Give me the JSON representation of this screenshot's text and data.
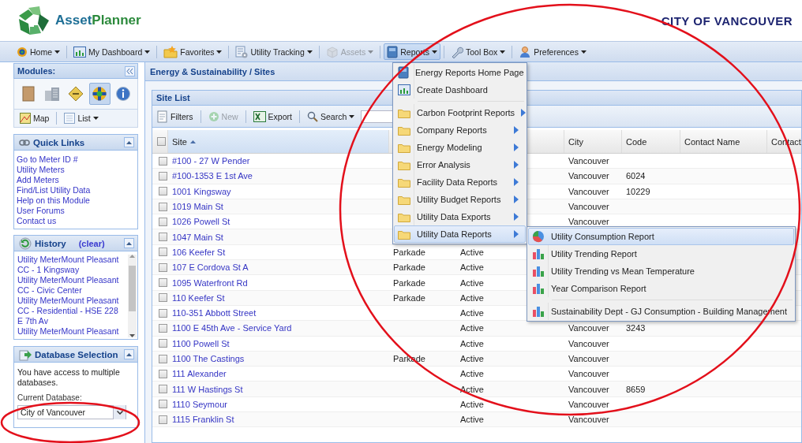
{
  "header": {
    "logo": [
      {
        "text": "Asset",
        "kind": "accent"
      },
      {
        "text": "Planner",
        "kind": "plain"
      }
    ],
    "organization": "CITY OF VANCOUVER"
  },
  "toolbar": [
    {
      "label": "Home",
      "dropdown": true,
      "disabled": false,
      "pressed": false
    },
    {
      "label": "My Dashboard",
      "dropdown": true,
      "disabled": false,
      "pressed": false
    },
    {
      "label": "Favorites",
      "dropdown": true,
      "disabled": false,
      "pressed": false
    },
    {
      "label": "Utility Tracking",
      "dropdown": true,
      "disabled": false,
      "pressed": false
    },
    {
      "label": "Assets",
      "dropdown": true,
      "disabled": true,
      "pressed": false
    },
    {
      "label": "Reports",
      "dropdown": true,
      "disabled": false,
      "pressed": true
    },
    {
      "label": "Tool Box",
      "dropdown": true,
      "disabled": false,
      "pressed": false
    },
    {
      "label": "Preferences",
      "dropdown": true,
      "disabled": false,
      "pressed": false
    }
  ],
  "sidebar": {
    "title": "Modules:",
    "modules": [
      {
        "selected": false
      },
      {
        "selected": false
      },
      {
        "selected": false
      },
      {
        "selected": true
      },
      {
        "selected": false
      }
    ],
    "views": [
      {
        "label": "Map",
        "dropdown": false
      },
      {
        "label": "List",
        "dropdown": true
      }
    ],
    "quick_links": {
      "title": "Quick Links",
      "links": [
        "Go to Meter ID #",
        "Utility Meters",
        "Add Meters",
        "Find/List Utility Data",
        "Help on this Module",
        "User Forums",
        "Contact us"
      ]
    },
    "history": {
      "title": "History",
      "clear": "(clear)",
      "items": [
        "Utility MeterMount Pleasant CC - 1 Kingsway",
        "Utility MeterMount Pleasant CC - Civic Center",
        "Utility MeterMount Pleasant CC - Residential - HSE 228 E 7th Av",
        "Utility MeterMount Pleasant"
      ]
    },
    "database": {
      "title": "Database Selection",
      "note": "You have access to multiple databases.",
      "field_label": "Current Database:",
      "value": "City of Vancouver"
    }
  },
  "breadcrumb": "Energy & Sustainability / Sites",
  "site_list": {
    "title": "Site List",
    "tools": [
      {
        "label": "Filters",
        "disabled": false,
        "dropdown": false
      },
      {
        "label": "New",
        "disabled": true,
        "dropdown": false
      },
      {
        "label": "Export",
        "disabled": false,
        "dropdown": false
      },
      {
        "label": "Search",
        "disabled": false,
        "dropdown": true
      }
    ],
    "select_all": {
      "checked": false
    },
    "columns": [
      {
        "label": "Site",
        "sorted": true
      },
      {
        "label": "City",
        "sorted": false
      },
      {
        "label": "Code",
        "sorted": false
      },
      {
        "label": "Contact Name",
        "sorted": false
      },
      {
        "label": "Contact",
        "sorted": false
      }
    ],
    "rows": [
      {
        "checked": false,
        "site": "#100 - 27 W Pender",
        "city": "Vancouver"
      },
      {
        "checked": false,
        "site": "#100-1353 E 1st Ave",
        "city": "Vancouver",
        "code": "6024"
      },
      {
        "checked": false,
        "site": "1001 Kingsway",
        "city": "Vancouver",
        "code": "10229"
      },
      {
        "checked": false,
        "site": "1019 Main St",
        "city": "Vancouver"
      },
      {
        "checked": false,
        "site": "1026 Powell St",
        "city": "Vancouver"
      },
      {
        "checked": false,
        "site": "1047 Main St"
      },
      {
        "checked": false,
        "site": "106 Keefer St",
        "column_2": "Parkade",
        "column_3": "Active"
      },
      {
        "checked": false,
        "site": "107 E Cordova St A",
        "column_2": "Parkade",
        "column_3": "Active"
      },
      {
        "checked": false,
        "site": "1095 Waterfront Rd",
        "column_2": "Parkade",
        "column_3": "Active"
      },
      {
        "checked": false,
        "site": "110 Keefer St",
        "column_2": "Parkade",
        "column_3": "Active"
      },
      {
        "checked": false,
        "site": "110-351 Abbott Street",
        "column_3": "Active"
      },
      {
        "checked": false,
        "site": "1100 E 45th Ave - Service Yard",
        "column_3": "Active",
        "city": "Vancouver",
        "code": "3243"
      },
      {
        "checked": false,
        "site": "1100 Powell St",
        "column_3": "Active",
        "city": "Vancouver"
      },
      {
        "checked": false,
        "site": "1100 The Castings",
        "column_2": "Parkade",
        "column_3": "Active",
        "city": "Vancouver"
      },
      {
        "checked": false,
        "site": "111 Alexander",
        "column_3": "Active",
        "city": "Vancouver"
      },
      {
        "checked": false,
        "site": "111 W Hastings St",
        "column_3": "Active",
        "city": "Vancouver",
        "code": "8659"
      },
      {
        "checked": false,
        "site": "1110 Seymour",
        "column_3": "Active",
        "city": "Vancouver"
      },
      {
        "checked": false,
        "site": "1115 Franklin St",
        "column_3": "Active",
        "city": "Vancouver"
      }
    ]
  },
  "reports_menu": {
    "items": [
      {
        "kind": "command",
        "label": "Energy Reports Home Page",
        "selected": false
      },
      {
        "kind": "command",
        "label": "Create Dashboard",
        "selected": false
      },
      {
        "kind": "separator"
      },
      {
        "kind": "folder",
        "label": "Carbon Footprint Reports",
        "selected": false
      },
      {
        "kind": "folder",
        "label": "Company Reports",
        "selected": false
      },
      {
        "kind": "folder",
        "label": "Energy Modeling",
        "selected": false
      },
      {
        "kind": "folder",
        "label": "Error Analysis",
        "selected": false
      },
      {
        "kind": "folder",
        "label": "Facility Data Reports",
        "selected": false
      },
      {
        "kind": "folder",
        "label": "Utility Budget Reports",
        "selected": false
      },
      {
        "kind": "folder",
        "label": "Utility Data Exports",
        "selected": false
      },
      {
        "kind": "folder",
        "label": "Utility Data Reports",
        "selected": true
      }
    ]
  },
  "submenu": {
    "items": [
      {
        "kind": "report",
        "label": "Utility Consumption Report",
        "selected": true
      },
      {
        "kind": "report",
        "label": "Utility Trending Report",
        "selected": false
      },
      {
        "kind": "report",
        "label": "Utility Trending vs Mean Temperature",
        "selected": false
      },
      {
        "kind": "report",
        "label": "Year Comparison Report",
        "selected": false
      },
      {
        "kind": "separator"
      },
      {
        "kind": "report",
        "label": "Sustainability Dept - GJ Consumption - Building Management",
        "selected": false
      }
    ]
  },
  "annotations": [
    {
      "kind": "ellipse",
      "color": "#e3101b"
    },
    {
      "kind": "ellipse",
      "color": "#e3101b"
    }
  ]
}
